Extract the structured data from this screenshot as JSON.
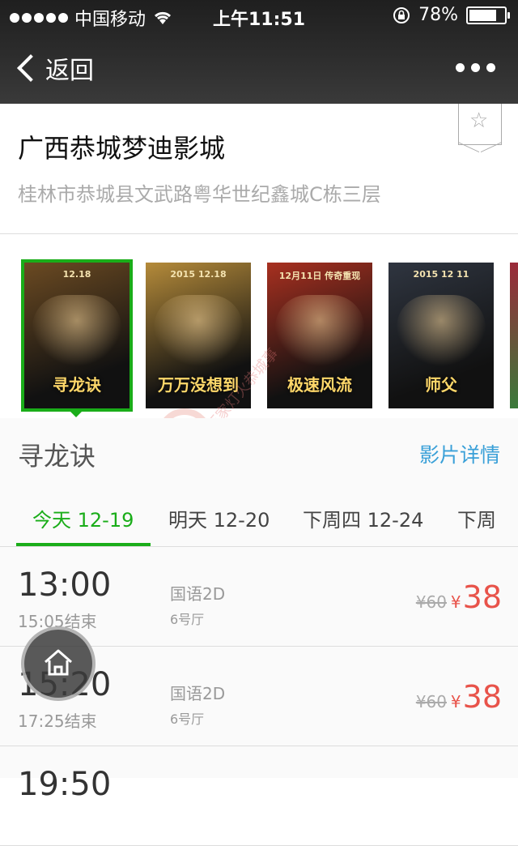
{
  "status_bar": {
    "carrier": "中国移动",
    "time": "上午11:51",
    "battery": "78%",
    "battery_level": 0.78
  },
  "nav": {
    "back_label": "返回",
    "more_icon": "more-dots-icon"
  },
  "cinema": {
    "name": "广西恭城梦迪影城",
    "address": "桂林市恭城县文武路粤华世纪鑫城C栋三层",
    "favorite_icon": "star-bookmark-icon"
  },
  "posters": [
    {
      "movie": "寻龙诀",
      "selected": true,
      "theme": "#6b4a22",
      "banner": "寻龙诀",
      "date_text": "12.18"
    },
    {
      "movie": "万万没想到",
      "selected": false,
      "theme": "#b58b3a",
      "banner": "万万没想到",
      "date_text": "2015 12.18"
    },
    {
      "movie": "极速风流",
      "selected": false,
      "theme": "#a83020",
      "banner": "极速风流",
      "date_text": "12月11日 传奇重现"
    },
    {
      "movie": "师父",
      "selected": false,
      "theme": "#2f3540",
      "banner": "师父",
      "date_text": "2015 12 11"
    }
  ],
  "movie": {
    "title": "寻龙诀",
    "detail_link": "影片详情"
  },
  "date_tabs": [
    {
      "label": "今天 12-19",
      "active": true
    },
    {
      "label": "明天 12-20",
      "active": false
    },
    {
      "label": "下周四 12-24",
      "active": false
    },
    {
      "label": "下周",
      "active": false
    }
  ],
  "showtimes": [
    {
      "start": "13:00",
      "end": "15:05结束",
      "language": "国语2D",
      "hall": "6号厅",
      "original_price": "60",
      "price": "38"
    },
    {
      "start": "15:20",
      "end": "17:25结束",
      "language": "国语2D",
      "hall": "6号厅",
      "original_price": "60",
      "price": "38"
    },
    {
      "start": "19:50",
      "end": "",
      "language": "",
      "hall": "",
      "original_price": "",
      "price": ""
    }
  ],
  "currency_symbol": "¥",
  "watermark_text": "万家灯火恭城事",
  "colors": {
    "accent_green": "#1aad19",
    "link_blue": "#3aa0d8",
    "price_red": "#e8534a"
  }
}
